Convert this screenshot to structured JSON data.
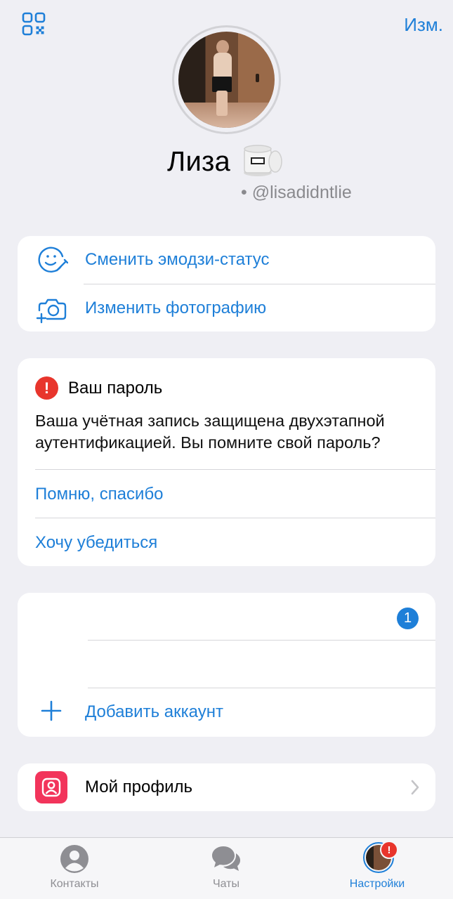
{
  "header": {
    "qr_icon": "qr-code-icon",
    "edit_label": "Изм."
  },
  "profile": {
    "name": "Лиза",
    "emoji_status": "candle-emoji",
    "username": "• @lisadidntlie"
  },
  "actions": {
    "items": [
      {
        "icon": "smiley-edit-icon",
        "label": "Сменить эмодзи-статус"
      },
      {
        "icon": "camera-add-icon",
        "label": "Изменить фотографию"
      }
    ]
  },
  "password_card": {
    "alert_icon": "!",
    "title": "Ваш пароль",
    "text": "Ваша учётная запись защищена двухэтапной аутентификацией. Вы помните свой пароль?",
    "option_remember": "Помню, спасибо",
    "option_verify": "Хочу убедиться"
  },
  "accounts": {
    "unread_badge": "1",
    "add_account_label": "Добавить аккаунт"
  },
  "my_profile": {
    "label": "Мой профиль"
  },
  "tabbar": {
    "tabs": [
      {
        "label": "Контакты",
        "icon": "person-circle-icon"
      },
      {
        "label": "Чаты",
        "icon": "chat-bubbles-icon"
      },
      {
        "label": "Настройки",
        "icon": "avatar",
        "alert": "!"
      }
    ]
  },
  "colors": {
    "accent": "#1e7fd8",
    "alert": "#e8352c",
    "background": "#efeff4",
    "profile_icon": "#f2345b"
  }
}
